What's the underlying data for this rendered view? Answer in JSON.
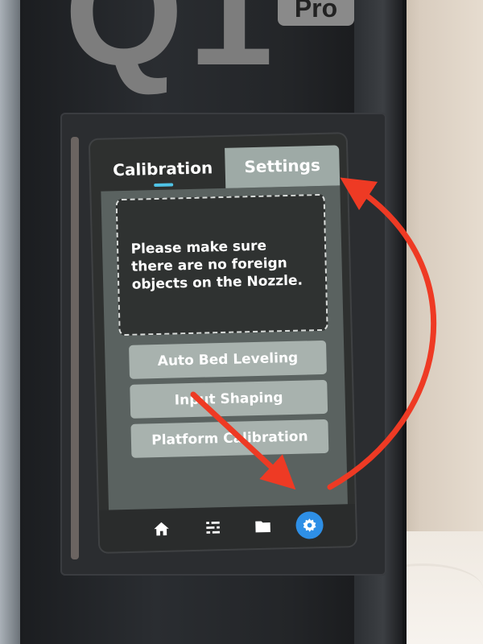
{
  "device": {
    "logo_text": "Q1",
    "logo_badge": "Pro"
  },
  "tabs": [
    {
      "label": "Calibration",
      "active": true
    },
    {
      "label": "Settings",
      "active": false
    }
  ],
  "notice": {
    "text": "Please make sure there are no foreign objects on the Nozzle."
  },
  "buttons": [
    {
      "label": "Auto Bed Leveling"
    },
    {
      "label": "Input Shaping"
    },
    {
      "label": "Platform Calibration"
    }
  ],
  "navbar": {
    "items": [
      {
        "icon": "home-icon"
      },
      {
        "icon": "list-icon"
      },
      {
        "icon": "folder-icon"
      },
      {
        "icon": "gear-icon",
        "active": true
      }
    ]
  },
  "colors": {
    "accent": "#2e8fe6",
    "tab_underline": "#4fc3e6",
    "annotation_arrow": "#ee3a24"
  }
}
